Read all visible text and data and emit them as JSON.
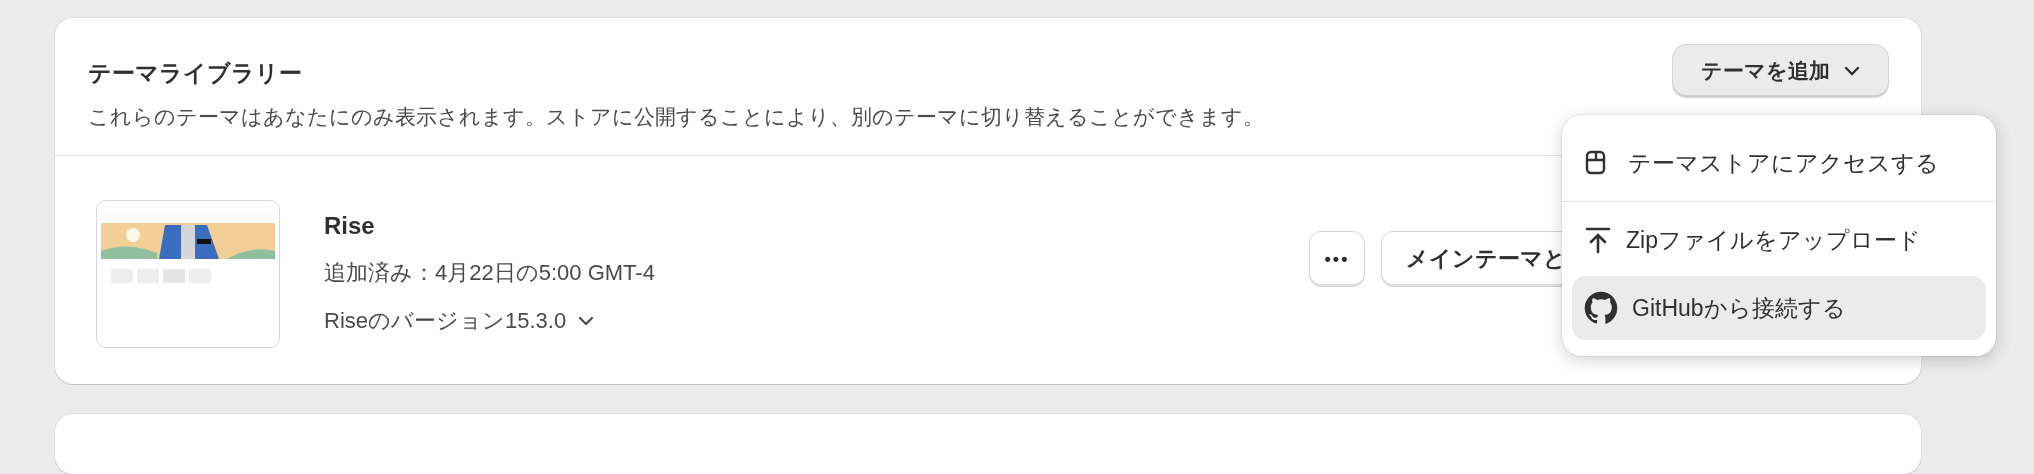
{
  "library": {
    "title": "テーマライブラリー",
    "description": "これらのテーマはあなたにのみ表示されます。ストアに公開することにより、別のテーマに切り替えることができます。",
    "add_button": {
      "label": "テーマを追加",
      "expanded": true
    }
  },
  "themes": [
    {
      "name": "Rise",
      "added": "追加済み：4月22日の5:00 GMT-4",
      "version": "Riseのバージョン15.3.0",
      "more_label": "•••",
      "main_button": "メインテーマと"
    }
  ],
  "menu": {
    "sections": [
      [
        {
          "label": "テーマストアにアクセスする",
          "selected": false
        }
      ],
      [
        {
          "label": "Zipファイルをアップロード",
          "selected": false
        },
        {
          "label": "GitHubから接続する",
          "selected": true
        }
      ]
    ]
  }
}
